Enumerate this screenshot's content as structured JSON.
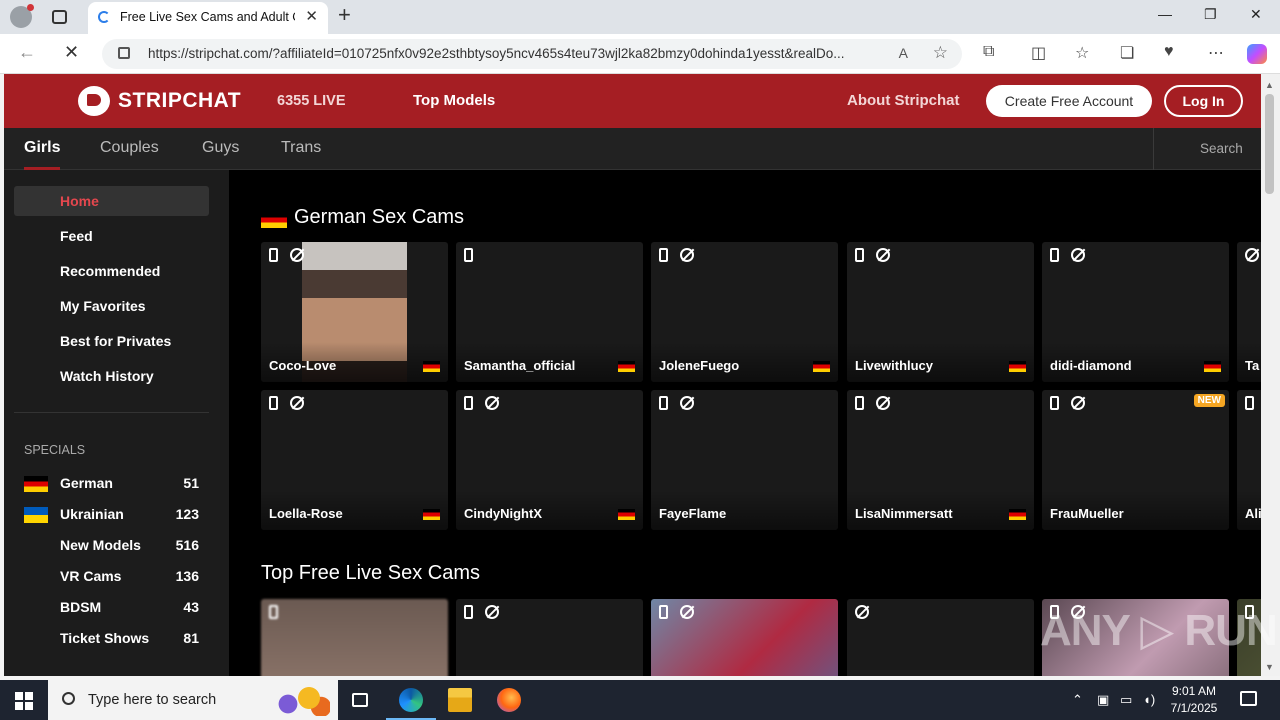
{
  "browser": {
    "tab_title": "Free Live Sex Cams and Adult Chat",
    "url": "https://stripchat.com/?affiliateId=010725nfx0v92e2sthbtysoy5ncv465s4teu73wjl2ka82bmzy0dohinda1yesst&realDo...",
    "new_tab_symbol": "+",
    "tab_close_symbol": "✕",
    "min_symbol": "—",
    "restore_symbol": "❐",
    "close_symbol": "✕",
    "back_symbol": "←",
    "reload_symbol": "✕",
    "readaloud_symbol": "A",
    "star_symbol": "☆"
  },
  "header": {
    "logo": "STRIPCHAT",
    "live_count": "6355 LIVE",
    "top_models": "Top Models",
    "about": "About Stripchat",
    "create_account": "Create Free Account",
    "login": "Log In"
  },
  "subnav": {
    "categories": [
      "Girls",
      "Couples",
      "Guys",
      "Trans"
    ],
    "search": "Search"
  },
  "sidebar": {
    "items": [
      "Home",
      "Feed",
      "Recommended",
      "My Favorites",
      "Best for Privates",
      "Watch History"
    ],
    "specials_title": "SPECIALS",
    "specials": [
      {
        "name": "German",
        "count": "51",
        "flag": "de"
      },
      {
        "name": "Ukrainian",
        "count": "123",
        "flag": "ua"
      },
      {
        "name": "New Models",
        "count": "516"
      },
      {
        "name": "VR Cams",
        "count": "136"
      },
      {
        "name": "BDSM",
        "count": "43"
      },
      {
        "name": "Ticket Shows",
        "count": "81"
      }
    ]
  },
  "sections": {
    "german_title": "German Sex Cams",
    "top_title": "Top Free Live Sex Cams"
  },
  "german_row1": [
    "Coco-Love",
    "Samantha_official",
    "JoleneFuego",
    "Livewithlucy",
    "didi-diamond",
    "Ta"
  ],
  "german_row2": [
    "Loella-Rose",
    "CindyNightX",
    "FayeFlame",
    "LisaNimmersatt",
    "FrauMueller",
    "Ali"
  ],
  "badge_new": "NEW",
  "watermark": "ANY ▷ RUN",
  "taskbar": {
    "search_placeholder": "Type here to search",
    "time": "9:01 AM",
    "date": "7/1/2025"
  },
  "colors": {
    "brand": "#a51e23",
    "accent_text": "#e4474e"
  }
}
